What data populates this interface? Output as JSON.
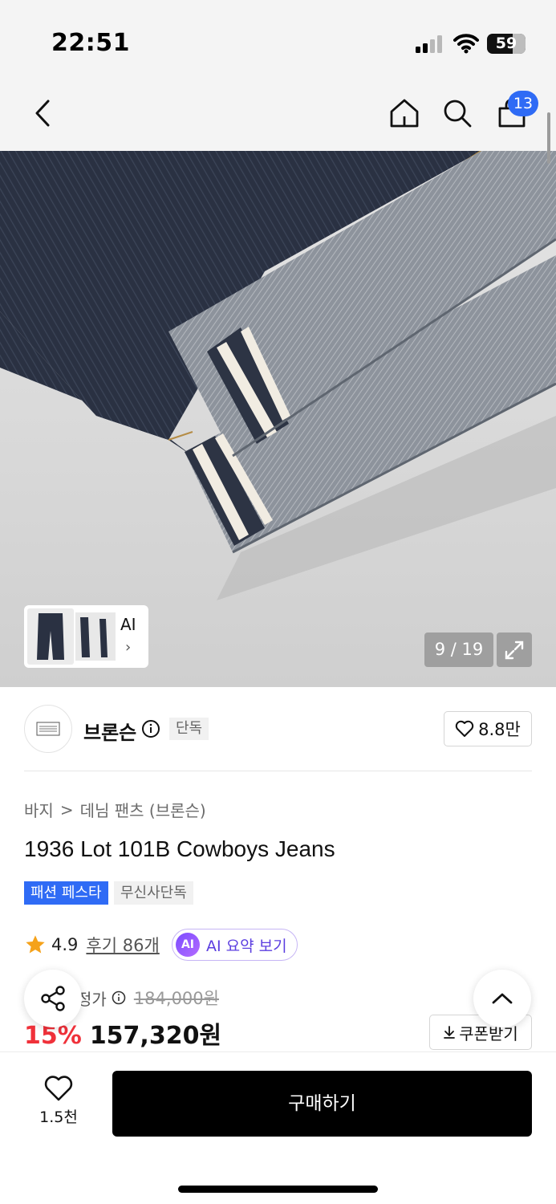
{
  "status_bar": {
    "time": "22:51",
    "battery": "59",
    "signal_icon": "cellular-signal-icon",
    "wifi_icon": "wifi-icon"
  },
  "nav": {
    "back_icon": "chevron-left-icon",
    "home_icon": "home-icon",
    "search_icon": "search-icon",
    "cart_icon": "shopping-bag-icon",
    "cart_count": "13"
  },
  "gallery": {
    "thumbnail_label": "AI",
    "thumbnail_chevron": "›",
    "counter": "9 / 19",
    "expand_icon": "expand-icon"
  },
  "brand": {
    "name": "브론슨",
    "exclusive_tag": "단독",
    "like_count": "8.8만"
  },
  "product": {
    "breadcrumb": [
      "바지",
      "데님 팬츠 (브론슨)"
    ],
    "breadcrumb_separator": ">",
    "title": "1936 Lot 101B Cowboys Jeans",
    "tags": [
      "패션 페스타",
      "무신사단독"
    ],
    "rating": "4.9",
    "review_link": "후기 86개",
    "ai_badge": "AI",
    "ai_summary_label": "AI 요약 보기"
  },
  "price": {
    "label": "정가",
    "original": "184,000원",
    "discount": "15%",
    "sale": "157,320원",
    "coupon_label": "쿠폰받기"
  },
  "bottom_bar": {
    "like_count": "1.5천",
    "buy_label": "구매하기"
  },
  "colors": {
    "accent_blue": "#2f6bf5",
    "discount_red": "#f0313a",
    "ai_purple": "#7b4bff",
    "star_orange": "#f5a21a"
  }
}
